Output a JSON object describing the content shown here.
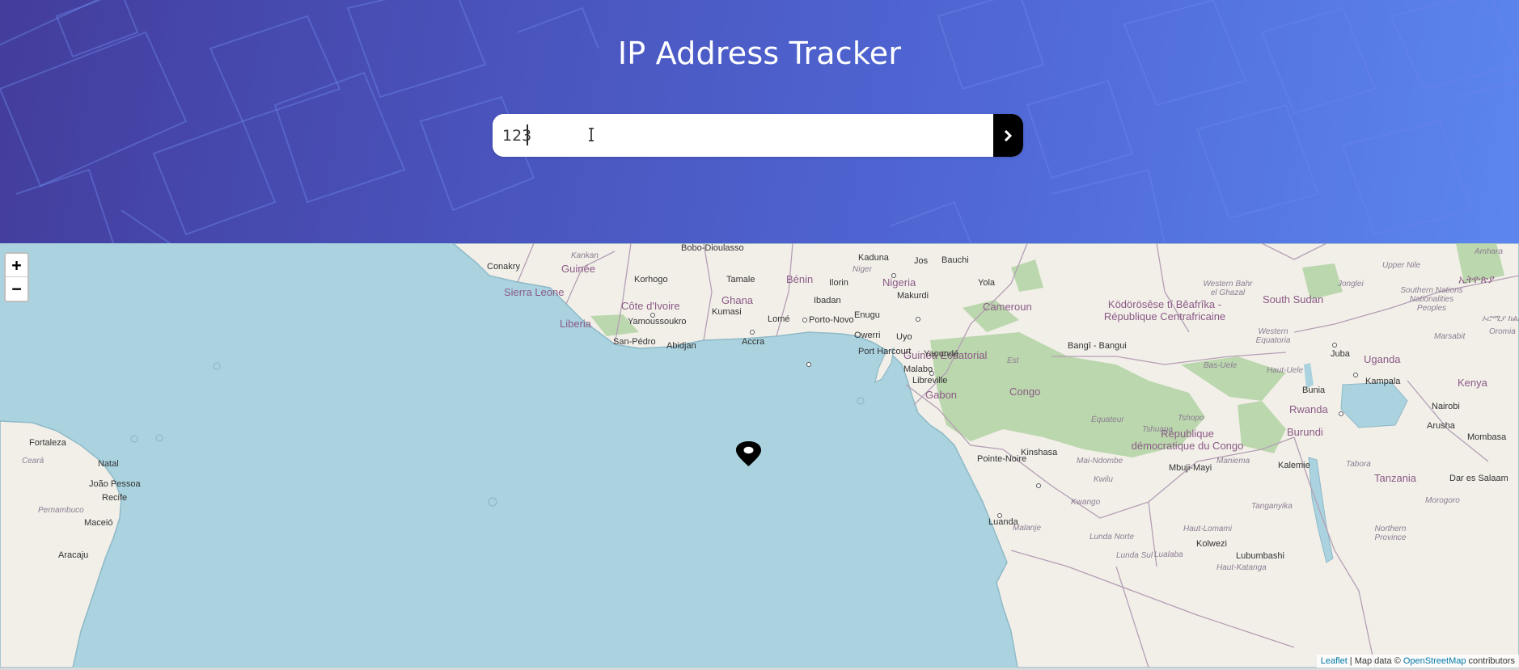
{
  "header": {
    "title": "IP Address Tracker",
    "background_colors": [
      "#433d9c",
      "#5c86ee"
    ]
  },
  "search": {
    "value": "123",
    "placeholder": "",
    "submit_icon": "chevron-right-icon"
  },
  "map": {
    "water_color": "#aad3df",
    "land_color": "#f2efe9",
    "forest_color": "#add19e",
    "marker_icon": "location-pin-icon",
    "zoom_in_label": "+",
    "zoom_out_label": "−",
    "attribution": {
      "leaflet": "Leaflet",
      "separator": " | Map data © ",
      "osm": "OpenStreetMap",
      "suffix": " contributors"
    },
    "countries": [
      "Guinée",
      "Sierra Leone",
      "Liberia",
      "Côte d'Ivoire",
      "Ghana",
      "Bénin",
      "Nigeria",
      "Cameroun",
      "Guinea Ecuatorial",
      "Gabon",
      "Congo",
      "Ködörösêse tî Bêafrîka - République Centrafricaine",
      "South Sudan",
      "République démocratique du Congo",
      "Uganda",
      "Kenya",
      "Rwanda",
      "Burundi",
      "Tanzania",
      "ኢትዮጵያ"
    ],
    "cities": [
      "Bobo-Dioulasso",
      "Conakry",
      "Korhogo",
      "Tamale",
      "Kaduna",
      "Jos",
      "Bauchi",
      "Ilorin",
      "Yola",
      "Makurdi",
      "Ibadan",
      "Yamoussoukro",
      "Kumasi",
      "Lomé",
      "Porto-Novo",
      "Enugu",
      "San-Pédro",
      "Abidjan",
      "Accra",
      "Owerri",
      "Uyo",
      "Port Harcourt",
      "Yaoundé",
      "Malabo",
      "Bangî - Bangui",
      "Juba",
      "Libreville",
      "Bunia",
      "Kampala",
      "Nairobi",
      "Arusha",
      "Mombasa",
      "Fortaleza",
      "Natal",
      "João Pessoa",
      "Recife",
      "Maceió",
      "Aracaju",
      "Pointe-Noire",
      "Kinshasa",
      "Mbuji-Mayi",
      "Kalemie",
      "Dar es Salaam",
      "Luanda",
      "Kolwezi",
      "Lubumbashi"
    ],
    "regions": [
      "Kankan",
      "Niger",
      "Western Bahr el Ghazal",
      "Jonglei",
      "Upper Nile",
      "Amhara",
      "Western Equatoria",
      "Bas-Uele",
      "Haut-Uele",
      "Est",
      "Équateur",
      "Tshopo",
      "Tshuapa",
      "Mai-Ndombe",
      "Maniema",
      "Kwilu",
      "Kwango",
      "Tanganyika",
      "Haut-Lomami",
      "Lunda Norte",
      "Lunda Sul",
      "Lualaba",
      "Haut-Katanga",
      "Malanje",
      "Tabora",
      "Morogoro",
      "Northern Province",
      "Ceará",
      "Pernambuco",
      "Marsabit",
      "Oromia",
      "ኦሮሚያ ክልል",
      "Southern Nations Nationalities Peoples"
    ]
  }
}
